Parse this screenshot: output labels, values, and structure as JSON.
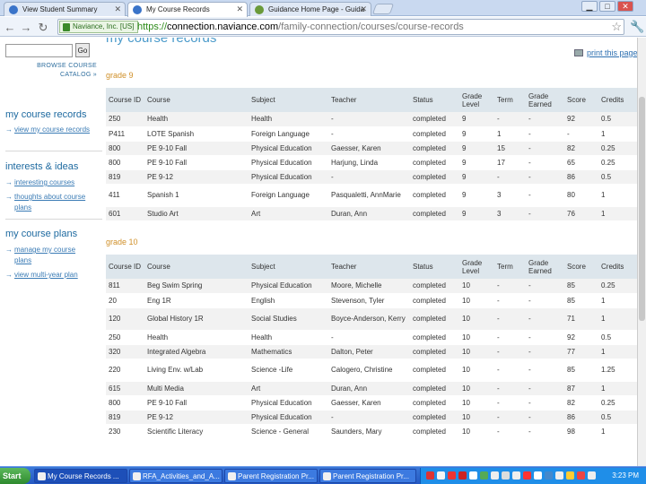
{
  "browser": {
    "tabs": [
      {
        "label": "View Student Summary",
        "active": false
      },
      {
        "label": "My Course Records",
        "active": true
      },
      {
        "label": "Guidance Home Page - Guida",
        "active": false
      }
    ],
    "secure_badge": "Naviance, Inc. [US]",
    "url_scheme": "https://",
    "url_domain": "connection.naviance.com",
    "url_path": "/family-connection/courses/course-records"
  },
  "sidebar": {
    "go_label": "Go",
    "browse_line1": "BROWSE COURSE",
    "browse_line2": "CATALOG »",
    "sections": [
      {
        "title": "my course records",
        "links": [
          "view my course records"
        ]
      },
      {
        "title": "interests & ideas",
        "links": [
          "interesting courses",
          "thoughts about course plans"
        ]
      },
      {
        "title": "my course plans",
        "links": [
          "manage my course plans",
          "view multi-year plan"
        ]
      }
    ]
  },
  "main": {
    "title": "my course records",
    "print_label": "print this page",
    "columns": [
      "Course ID",
      "Course",
      "Subject",
      "Teacher",
      "Status",
      "Grade Level",
      "Term",
      "Grade Earned",
      "Score",
      "Credits"
    ],
    "grades": [
      {
        "label": "grade 9",
        "rows": [
          [
            "250",
            "Health",
            "Health",
            "-",
            "completed",
            "9",
            "-",
            "-",
            "92",
            "0.5"
          ],
          [
            "P411",
            "LOTE Spanish",
            "Foreign Language",
            "-",
            "completed",
            "9",
            "1",
            "-",
            "-",
            "1"
          ],
          [
            "800",
            "PE 9-10 Fall",
            "Physical Education",
            "Gaesser, Karen",
            "completed",
            "9",
            "15",
            "-",
            "82",
            "0.25"
          ],
          [
            "800",
            "PE 9-10 Fall",
            "Physical Education",
            "Harjung, Linda",
            "completed",
            "9",
            "17",
            "-",
            "65",
            "0.25"
          ],
          [
            "819",
            "PE 9-12",
            "Physical Education",
            "-",
            "completed",
            "9",
            "-",
            "-",
            "86",
            "0.5"
          ],
          [
            "411",
            "Spanish 1",
            "Foreign Language",
            "Pasqualetti, AnnMarie",
            "completed",
            "9",
            "3",
            "-",
            "80",
            "1"
          ],
          [
            "601",
            "Studio Art",
            "Art",
            "Duran, Ann",
            "completed",
            "9",
            "3",
            "-",
            "76",
            "1"
          ]
        ]
      },
      {
        "label": "grade 10",
        "rows": [
          [
            "811",
            "Beg Swim Spring",
            "Physical Education",
            "Moore, Michelle",
            "completed",
            "10",
            "-",
            "-",
            "85",
            "0.25"
          ],
          [
            "20",
            "Eng 1R",
            "English",
            "Stevenson, Tyler",
            "completed",
            "10",
            "-",
            "-",
            "85",
            "1"
          ],
          [
            "120",
            "Global History 1R",
            "Social Studies",
            "Boyce-Anderson, Kerry",
            "completed",
            "10",
            "-",
            "-",
            "71",
            "1"
          ],
          [
            "250",
            "Health",
            "Health",
            "-",
            "completed",
            "10",
            "-",
            "-",
            "92",
            "0.5"
          ],
          [
            "320",
            "Integrated Algebra",
            "Mathematics",
            "Dalton, Peter",
            "completed",
            "10",
            "-",
            "-",
            "77",
            "1"
          ],
          [
            "220",
            "Living Env. w/Lab",
            "Science -Life",
            "Calogero, Christine",
            "completed",
            "10",
            "-",
            "-",
            "85",
            "1.25"
          ],
          [
            "615",
            "Multi Media",
            "Art",
            "Duran, Ann",
            "completed",
            "10",
            "-",
            "-",
            "87",
            "1"
          ],
          [
            "800",
            "PE 9-10 Fall",
            "Physical Education",
            "Gaesser, Karen",
            "completed",
            "10",
            "-",
            "-",
            "82",
            "0.25"
          ],
          [
            "819",
            "PE 9-12",
            "Physical Education",
            "-",
            "completed",
            "10",
            "-",
            "-",
            "86",
            "0.5"
          ],
          [
            "230",
            "Scientific Literacy",
            "Science - General",
            "Saunders, Mary",
            "completed",
            "10",
            "-",
            "-",
            "98",
            "1"
          ]
        ]
      }
    ]
  },
  "taskbar": {
    "start_label": "Start",
    "items": [
      {
        "label": "My Course Records ...",
        "active": true
      },
      {
        "label": "RFA_Activities_and_A...",
        "active": false
      },
      {
        "label": "Parent Registration Pr...",
        "active": false
      },
      {
        "label": "Parent Registration Pr...",
        "active": false
      }
    ],
    "clock": "3:23 PM"
  },
  "colors": {
    "accent": "#4a9aca",
    "grade_heading": "#d0902a",
    "link": "#3a7bb5",
    "table_header": "#dde6ec"
  }
}
